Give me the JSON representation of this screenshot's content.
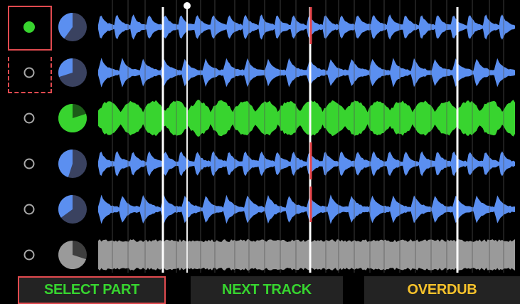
{
  "accent_colors": {
    "blue": "#5b8ff0",
    "green": "#38d42f",
    "gray": "#9a9a9a",
    "playhead_red": "#e7454b",
    "selection_red": "#e14a4f",
    "footer_green": "#37d42f",
    "footer_yellow": "#f5c12b"
  },
  "tracks": [
    {
      "name": "track-1",
      "color": "blue",
      "status": "playing",
      "progress": 0.4,
      "icon": "filled-dot"
    },
    {
      "name": "track-2",
      "color": "blue",
      "status": "idle",
      "progress": 0.3,
      "icon": "ring"
    },
    {
      "name": "track-3",
      "color": "green",
      "status": "idle",
      "progress": 0.8,
      "icon": "ring"
    },
    {
      "name": "track-4",
      "color": "blue",
      "status": "idle",
      "progress": 0.45,
      "icon": "ring"
    },
    {
      "name": "track-5",
      "color": "blue",
      "status": "idle",
      "progress": 0.35,
      "icon": "ring"
    },
    {
      "name": "track-6",
      "color": "gray",
      "status": "idle",
      "progress": 0.7,
      "icon": "ring"
    }
  ],
  "footer": {
    "left_label": "SELECT PART",
    "center_label": "NEXT TRACK",
    "right_label": "OVERDUB"
  }
}
